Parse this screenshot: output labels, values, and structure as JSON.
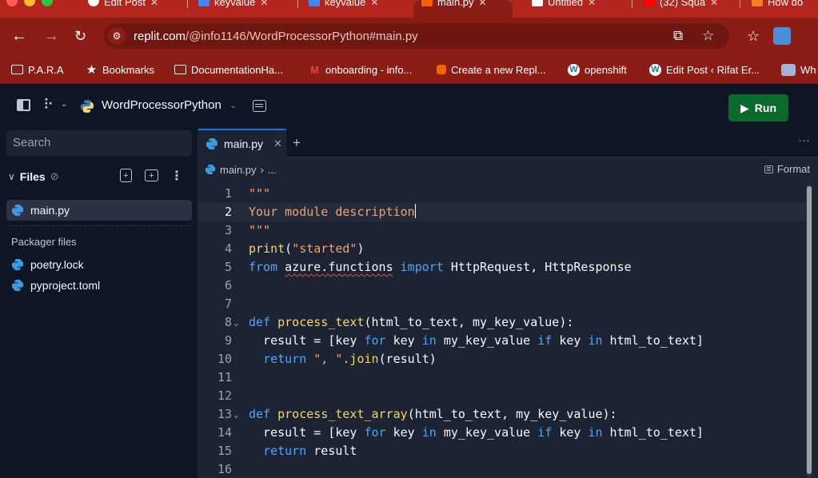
{
  "browser": {
    "tabs": [
      {
        "label": "Edit Post",
        "active": false
      },
      {
        "label": "keyvalue",
        "active": false
      },
      {
        "label": "keyvalue",
        "active": false
      },
      {
        "label": "main.py",
        "active": true
      },
      {
        "label": "Untitled",
        "active": false
      },
      {
        "label": "(32) Squa",
        "active": false
      },
      {
        "label": "How do",
        "active": false
      }
    ],
    "address": {
      "domain": "replit.com",
      "path": "/@info1146/WordProcessorPython#main.py"
    },
    "bookmarks": [
      {
        "label": "P.A.R.A",
        "icon": "folder-icon"
      },
      {
        "label": "Bookmarks",
        "icon": "star-icon"
      },
      {
        "label": "DocumentationHa...",
        "icon": "folder-icon"
      },
      {
        "label": "onboarding - info...",
        "icon": "gmail-icon"
      },
      {
        "label": "Create a new Repl...",
        "icon": "replit-icon"
      },
      {
        "label": "openshift",
        "icon": "wordpress-icon"
      },
      {
        "label": "Edit Post ‹ Rifat Er...",
        "icon": "wordpress-icon"
      },
      {
        "label": "Wh",
        "icon": "shield-icon"
      }
    ]
  },
  "header": {
    "repl_name": "WordProcessorPython",
    "run_label": "Run"
  },
  "sidebar": {
    "search_placeholder": "Search",
    "files_label": "Files",
    "open_file": "main.py",
    "packager_label": "Packager files",
    "packager_files": [
      "poetry.lock",
      "pyproject.toml"
    ]
  },
  "editor": {
    "tab_label": "main.py",
    "breadcrumb_file": "main.py",
    "breadcrumb_rest": "...",
    "format_label": "Format",
    "current_line": 2,
    "lines": [
      {
        "n": "1",
        "fold": false
      },
      {
        "n": "2",
        "fold": false
      },
      {
        "n": "3",
        "fold": false
      },
      {
        "n": "4",
        "fold": false
      },
      {
        "n": "5",
        "fold": false
      },
      {
        "n": "6",
        "fold": false
      },
      {
        "n": "7",
        "fold": false
      },
      {
        "n": "8",
        "fold": true
      },
      {
        "n": "9",
        "fold": false
      },
      {
        "n": "10",
        "fold": false
      },
      {
        "n": "11",
        "fold": false
      },
      {
        "n": "12",
        "fold": false
      },
      {
        "n": "13",
        "fold": true
      },
      {
        "n": "14",
        "fold": false
      },
      {
        "n": "15",
        "fold": false
      },
      {
        "n": "16",
        "fold": false
      }
    ],
    "code": {
      "l1": "\"\"\"",
      "l2": "Your module description",
      "l3": "\"\"\"",
      "l4_fn": "print",
      "l4_open": "(",
      "l4_str": "\"started\"",
      "l4_close": ")",
      "l5_from": "from",
      "l5_mod": "azure.functions",
      "l5_import": "import",
      "l5_names": "HttpRequest, HttpResponse",
      "def": "def",
      "l8_name": "process_text",
      "l8_params": "(html_to_text, my_key_value):",
      "l13_name": "process_text_array",
      "l13_params": "(html_to_text, my_key_value):",
      "result_eq": "  result = [key ",
      "for": "for",
      "key_sp": " key ",
      "in": "in",
      "my_key_value": " my_key_value ",
      "if": "if",
      "close_bracket": " html_to_text]",
      "return": "return",
      "l10_str": "\", \"",
      "l10_join": ".join",
      "l10_args": "(result)",
      "l15_rest": " result"
    }
  }
}
